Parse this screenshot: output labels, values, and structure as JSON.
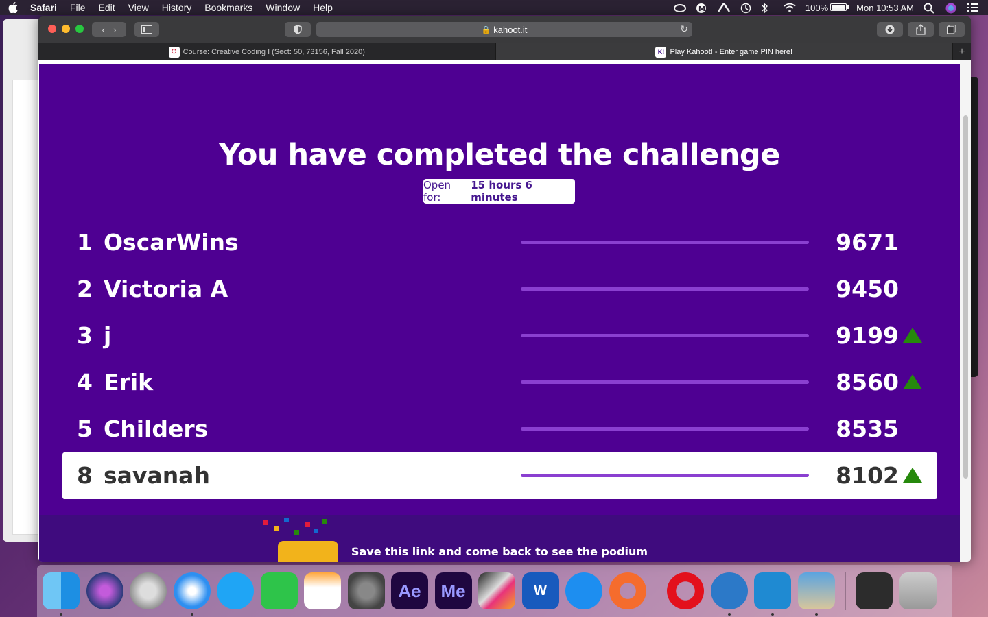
{
  "menubar": {
    "app": "Safari",
    "items": [
      "File",
      "Edit",
      "View",
      "History",
      "Bookmarks",
      "Window",
      "Help"
    ],
    "battery": "100%",
    "clock": "Mon 10:53 AM"
  },
  "browser": {
    "url": "kahoot.it",
    "tabs": [
      {
        "title": "Course: Creative Coding I (Sect: 50, 73156, Fall 2020)",
        "favicon": "power-icon"
      },
      {
        "title": "Play Kahoot! - Enter game PIN here!",
        "favicon": "kahoot-icon",
        "favicon_text": "K!"
      }
    ]
  },
  "kahoot": {
    "title": "You have completed the challenge",
    "open_for_label": "Open for:",
    "open_for_value": "15 hours 6 minutes",
    "leaderboard": [
      {
        "rank": "1",
        "name": "OscarWins",
        "score": "9671",
        "rising": false,
        "me": false
      },
      {
        "rank": "2",
        "name": "Victoria A",
        "score": "9450",
        "rising": false,
        "me": false
      },
      {
        "rank": "3",
        "name": "j",
        "score": "9199",
        "rising": true,
        "me": false
      },
      {
        "rank": "4",
        "name": "Erik",
        "score": "8560",
        "rising": true,
        "me": false
      },
      {
        "rank": "5",
        "name": "Childers",
        "score": "8535",
        "rising": false,
        "me": false
      },
      {
        "rank": "8",
        "name": "savanah",
        "score": "8102",
        "rising": true,
        "me": true
      }
    ],
    "save_link": "Save this link and come back to see the podium",
    "accent": "#4e0092",
    "up_color": "#26890c"
  },
  "dock": {
    "apps": [
      "Finder",
      "Siri",
      "Launchpad",
      "Safari",
      "Messages",
      "FaceTime",
      "Pages",
      "System Preferences",
      "After Effects",
      "Media Encoder",
      "Final Cut Pro",
      "Word",
      "App Store",
      "Origin",
      "Opera",
      "NordVPN",
      "Visual Studio Code",
      "Preview",
      "Screenshot",
      "Trash"
    ],
    "ae_label": "Ae",
    "me_label": "Me",
    "word_label": "W"
  }
}
